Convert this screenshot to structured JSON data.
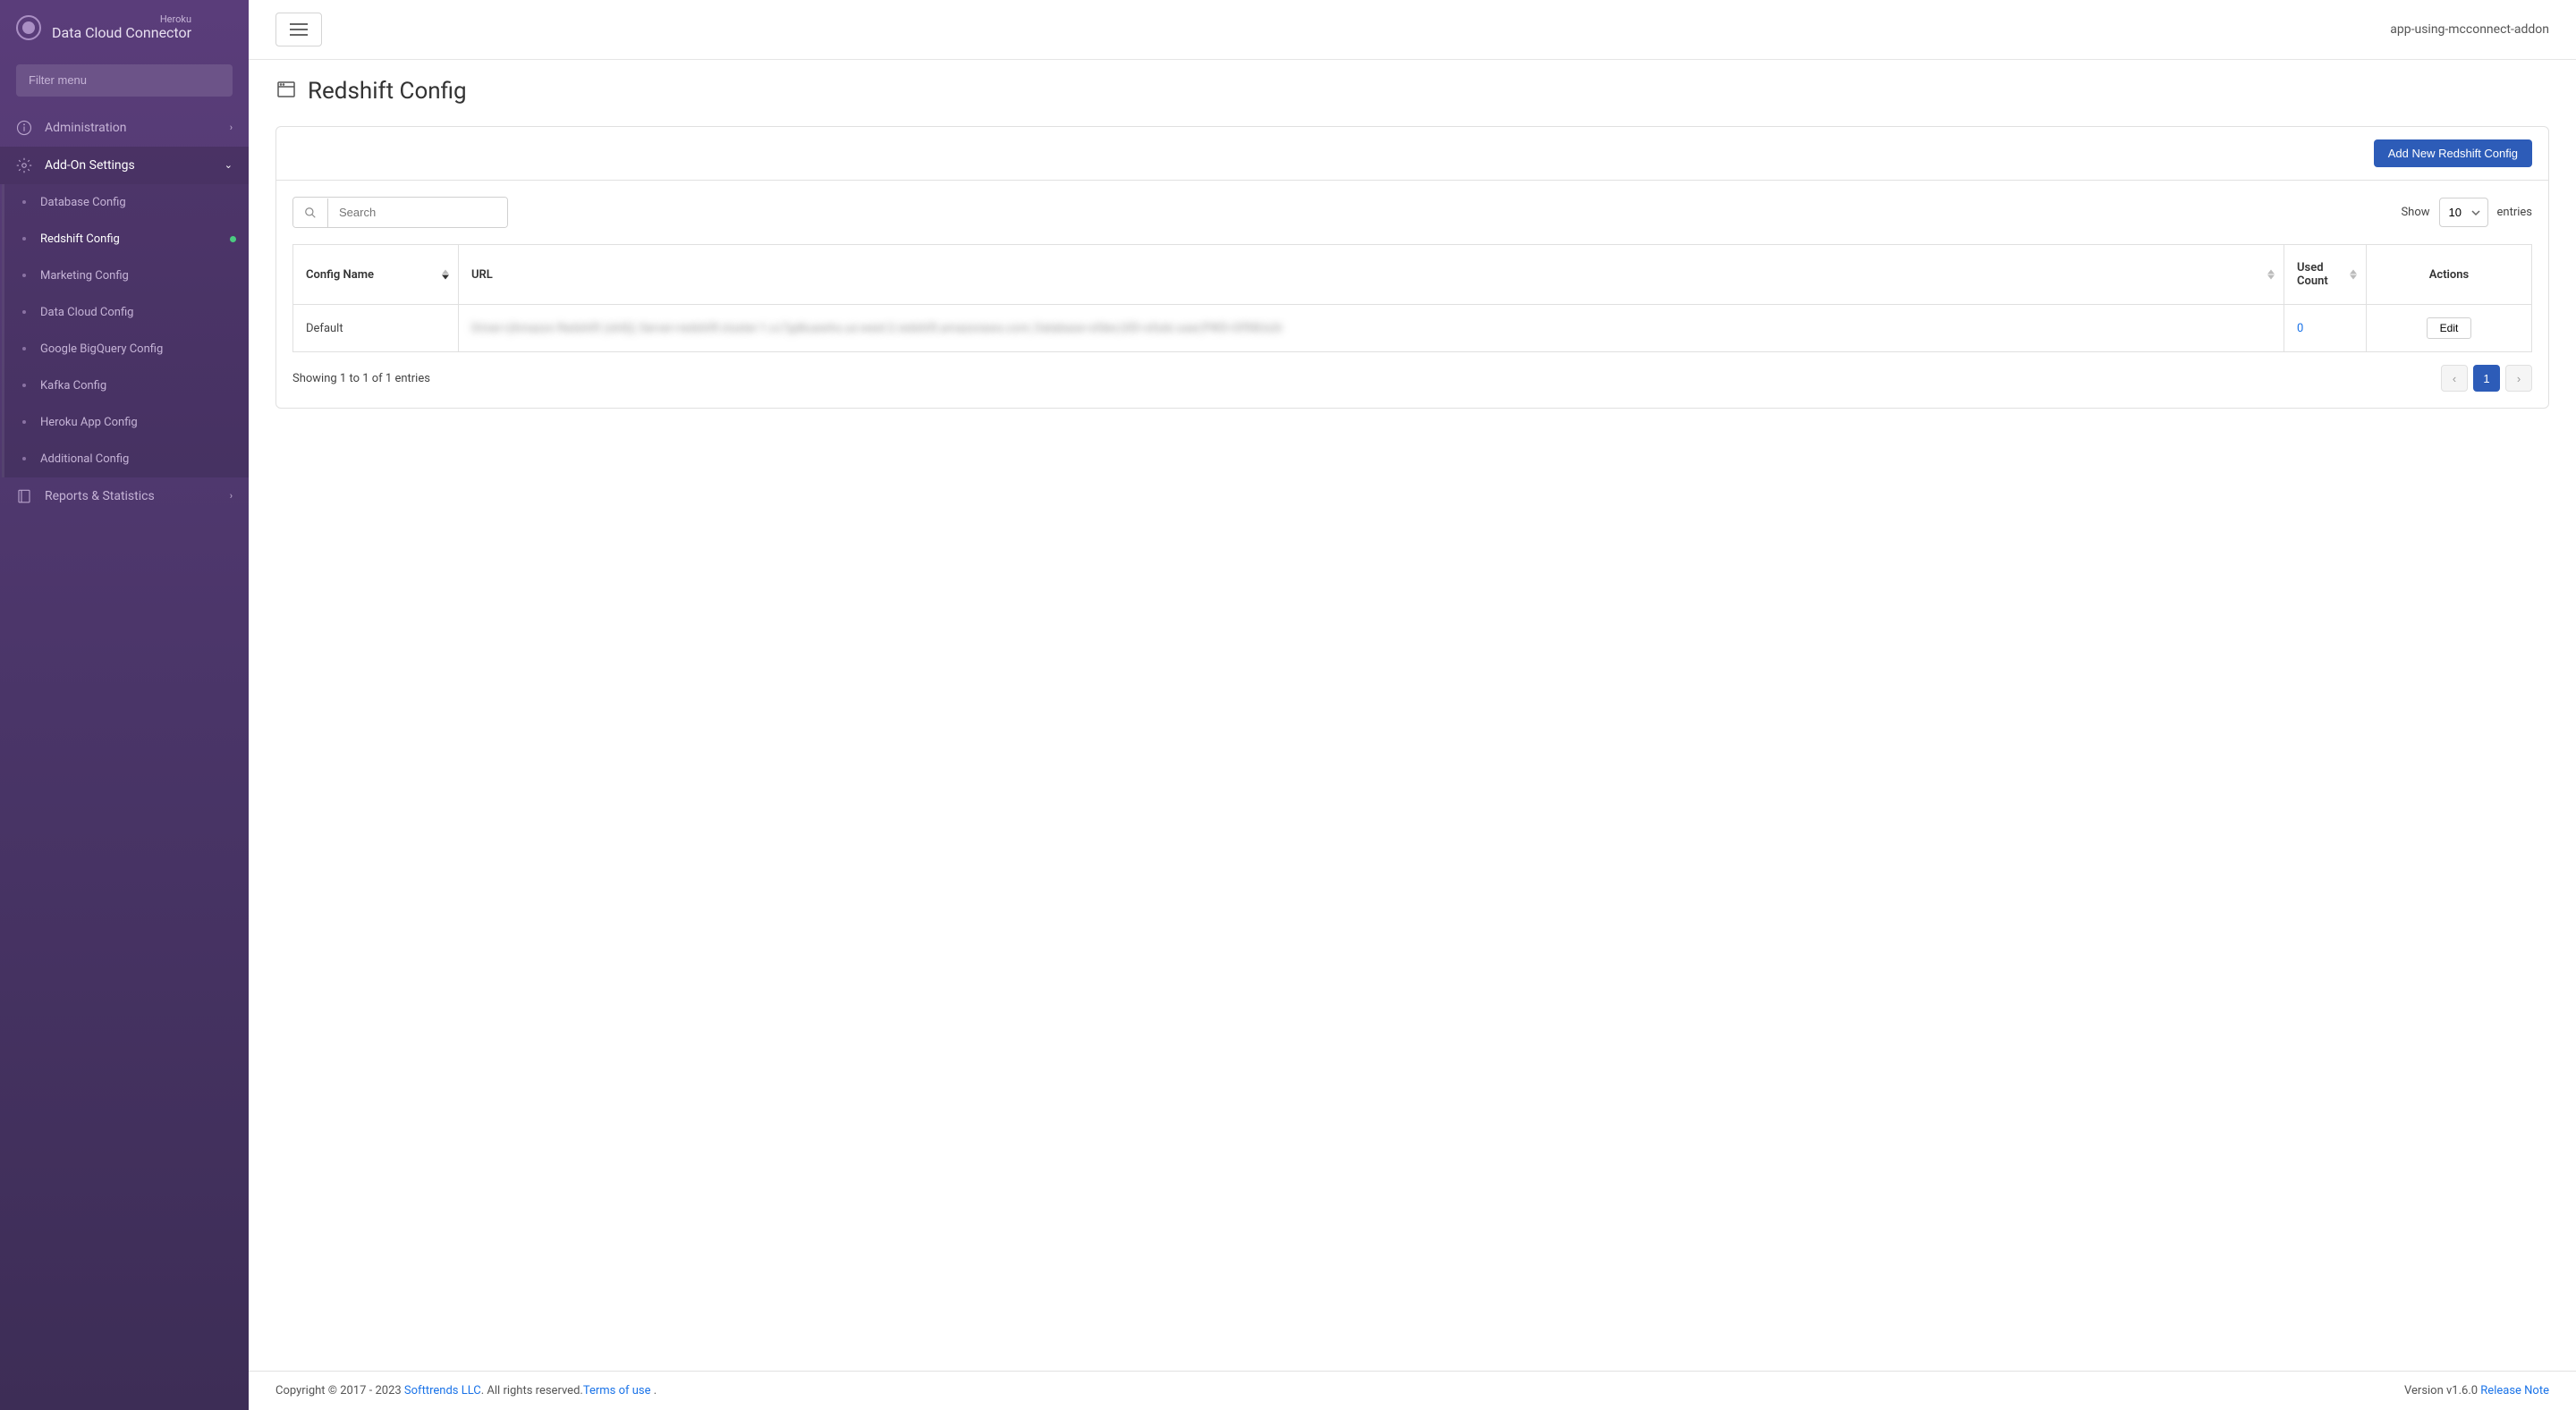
{
  "brand": {
    "small": "Heroku",
    "large": "Data Cloud Connector"
  },
  "sidebar": {
    "filter_placeholder": "Filter menu",
    "sections": [
      {
        "label": "Administration",
        "icon": "info-icon",
        "expanded": false
      },
      {
        "label": "Add-On Settings",
        "icon": "gear-icon",
        "expanded": true
      },
      {
        "label": "Reports & Statistics",
        "icon": "book-icon",
        "expanded": false
      }
    ],
    "addon_items": [
      {
        "label": "Database Config"
      },
      {
        "label": "Redshift Config",
        "active": true
      },
      {
        "label": "Marketing Config"
      },
      {
        "label": "Data Cloud Config"
      },
      {
        "label": "Google BigQuery Config"
      },
      {
        "label": "Kafka Config"
      },
      {
        "label": "Heroku App Config"
      },
      {
        "label": "Additional Config"
      }
    ]
  },
  "topbar": {
    "app_name": "app-using-mcconnect-addon"
  },
  "page": {
    "title": "Redshift Config",
    "add_button": "Add New Redshift Config",
    "search_placeholder": "Search",
    "show_label": "Show",
    "entries_label": "entries",
    "page_size": "10",
    "columns": {
      "name": "Config Name",
      "url": "URL",
      "count": "Used Count",
      "actions": "Actions"
    },
    "rows": [
      {
        "name": "Default",
        "url": "Driver={Amazon Redshift (x64)}; Server=redshift-cluster-1.cc7gdkuawho.us-west-2.redshift.amazonaws.com; Database=sfdev;UID=sfsdc-user;PWD=Df98Us3r",
        "count": "0",
        "edit_label": "Edit"
      }
    ],
    "showing_text": "Showing 1 to 1 of 1 entries",
    "current_page": "1"
  },
  "footer": {
    "copyright_prefix": "Copyright © 2017 - 2023 ",
    "company": "Softtrends LLC",
    "rights": ". All rights reserved.",
    "terms": "Terms of use",
    "dot": " .",
    "version_prefix": "Version v1.6.0  ",
    "release": "Release Note"
  }
}
